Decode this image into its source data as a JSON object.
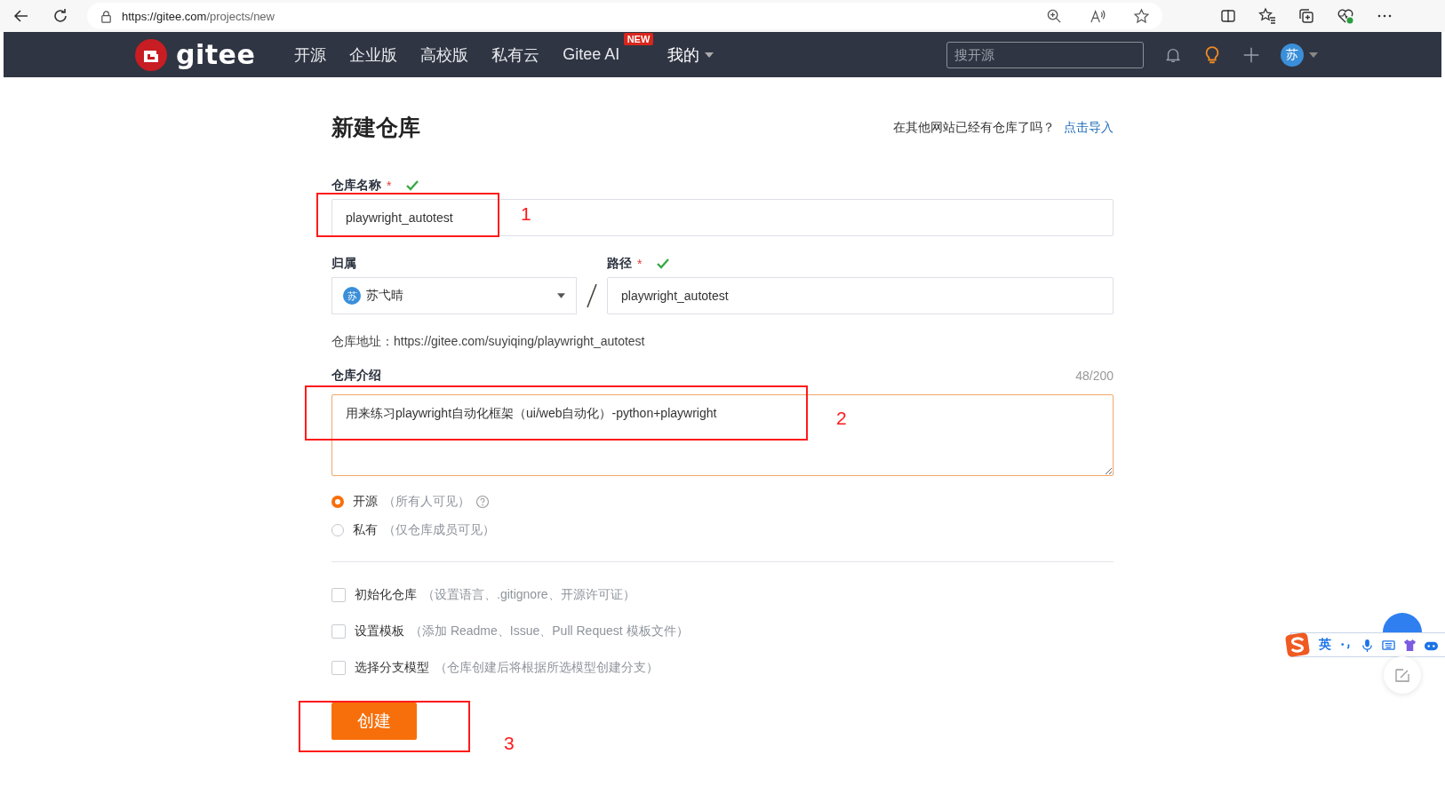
{
  "browser": {
    "url_host": "https://gitee.com",
    "url_path": "/projects/new"
  },
  "nav": {
    "logo": "gitee",
    "items": [
      {
        "label": "开源"
      },
      {
        "label": "企业版"
      },
      {
        "label": "高校版"
      },
      {
        "label": "私有云"
      },
      {
        "label": "Gitee AI",
        "badge": "NEW"
      }
    ],
    "mine": "我的",
    "search_placeholder": "搜开源",
    "avatar": "苏"
  },
  "page": {
    "title": "新建仓库",
    "import_prompt": "在其他网站已经有仓库了吗？",
    "import_link": "点击导入"
  },
  "name_field": {
    "label": "仓库名称",
    "required_mark": "*",
    "valid": true,
    "value": "playwright_autotest",
    "annotation": "1"
  },
  "owner": {
    "label": "归属",
    "avatar": "苏",
    "value": "苏弋晴"
  },
  "path_field": {
    "label": "路径",
    "required_mark": "*",
    "valid": true,
    "value": "playwright_autotest"
  },
  "address": {
    "label": "仓库地址：",
    "value": "https://gitee.com/suyiqing/playwright_autotest"
  },
  "intro": {
    "label": "仓库介绍",
    "count": "48/200",
    "value": "用来练习playwright自动化框架（ui/web自动化）-python+playwright",
    "annotation": "2"
  },
  "visibility": [
    {
      "label": "开源",
      "hint": "（所有人可见）",
      "selected": true,
      "help": true
    },
    {
      "label": "私有",
      "hint": "（仅仓库成员可见）",
      "selected": false,
      "help": false
    }
  ],
  "options": [
    {
      "label": "初始化仓库",
      "hint": "（设置语言、.gitignore、开源许可证）",
      "checked": false
    },
    {
      "label": "设置模板",
      "hint": "（添加 Readme、Issue、Pull Request 模板文件）",
      "checked": false
    },
    {
      "label": "选择分支模型",
      "hint": "（仓库创建后将根据所选模型创建分支）",
      "checked": false
    }
  ],
  "submit": {
    "label": "创建",
    "annotation": "3"
  },
  "ime_toolbar": {
    "mode": "英"
  }
}
